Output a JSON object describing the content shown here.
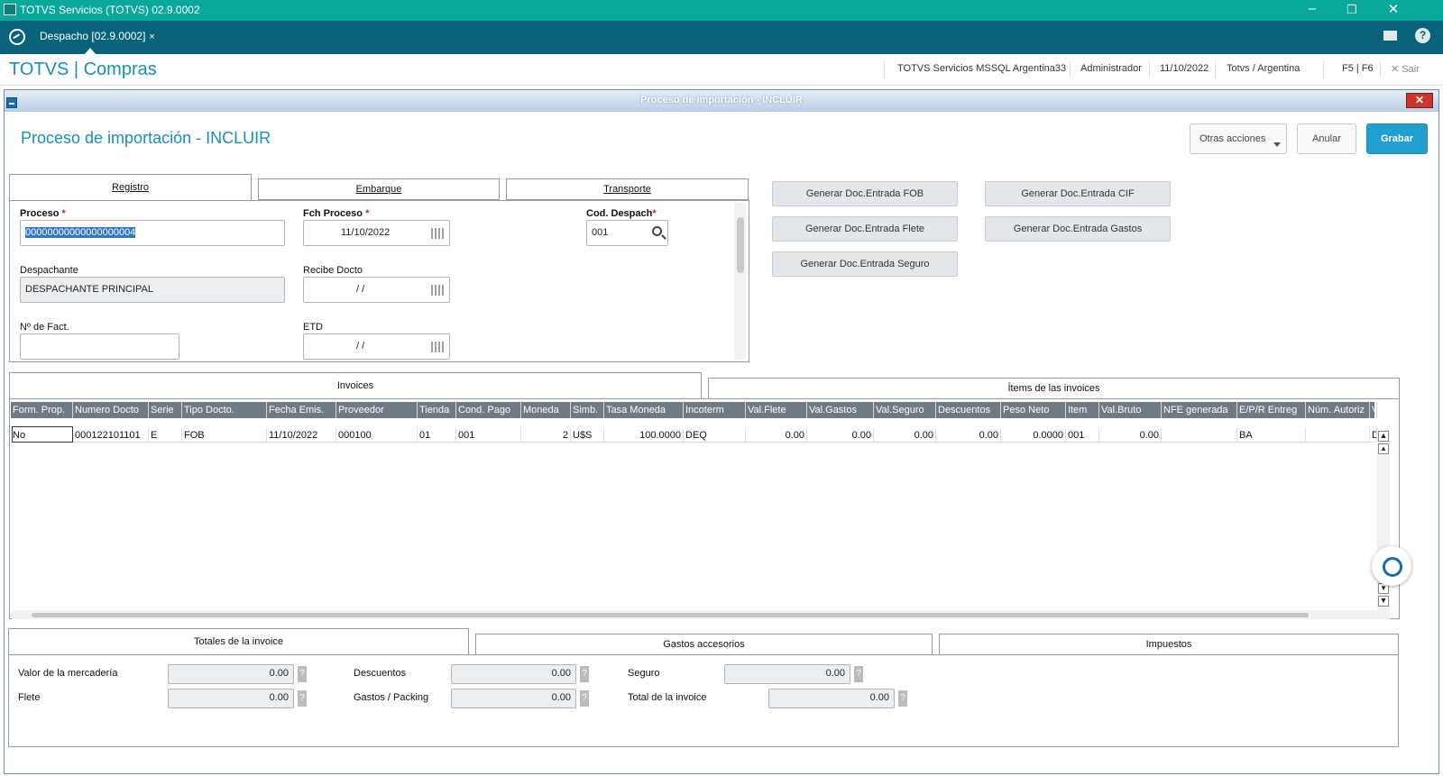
{
  "window": {
    "title": "TOTVS Servicios (TOTVS) 02.9.0002",
    "minimize": "–",
    "maximize": "❐",
    "close": "✕"
  },
  "tab": {
    "label": "Despacho [02.9.0002]",
    "close": "×"
  },
  "topicons": {
    "help": "?"
  },
  "header": {
    "brand": "TOTVS | Compras",
    "server": "TOTVS Servicios MSSQL Argentina33",
    "user": "Administrador",
    "date": "11/10/2022",
    "branch": "Totvs / Argentina",
    "shortcut": "F5 | F6",
    "exit": "✕  Sair"
  },
  "dialog": {
    "bar_title": "Proceso de importación - INCLUIR",
    "page_title": "Proceso de importación - INCLUIR",
    "close": "✕",
    "actions": {
      "other": "Otras acciones",
      "cancel": "Anular",
      "save": "Grabar"
    }
  },
  "top_tabs": [
    "Registro",
    "Embarque",
    "Transporte"
  ],
  "form": {
    "proceso_label": "Proceso",
    "proceso_value": "00000000000000000004",
    "fch_label": "Fch Proceso",
    "fch_value": "11/10/2022",
    "cod_label": "Cod. Despach",
    "cod_value": "001",
    "desp_label": "Despachante",
    "desp_value": "DESPACHANTE PRINCIPAL",
    "recibe_label": "Recibe Docto",
    "recibe_value": "/ /",
    "fact_label": "Nº de Fact.",
    "fact_value": "",
    "etd_label": "ETD",
    "etd_value": "/ /",
    "req": "*"
  },
  "gen_buttons": {
    "fob": "Generar Doc.Entrada FOB",
    "cif": "Generar Doc.Entrada CIF",
    "flete": "Generar Doc.Entrada Flete",
    "gastos": "Generar Doc.Entrada Gastos",
    "seguro": "Generar Doc.Entrada Seguro"
  },
  "mid_tabs": [
    "Invoices",
    "Ítems de las invoices"
  ],
  "grid": {
    "columns": [
      "Form. Prop.",
      "Numero Docto",
      "Serie",
      "Tipo Docto.",
      "Fecha Emis.",
      "Proveedor",
      "Tienda",
      "Cond. Pago",
      "Moneda",
      "Simb.",
      "Tasa Moneda",
      "Incoterm",
      "Val.Flete",
      "Val.Gastos",
      "Val.Seguro",
      "Descuentos",
      "Peso Neto",
      "Item",
      "Val.Bruto",
      "NFE generada",
      "E/P/R Entreg",
      "Núm. Autoriz",
      "V"
    ],
    "rows": [
      [
        "No",
        "000122101101",
        "E",
        "FOB",
        "11/10/2022",
        "000100",
        "01",
        "001",
        "2",
        "U$S",
        "100.0000",
        "DEQ",
        "0.00",
        "0.00",
        "0.00",
        "0.00",
        "0.0000",
        "001",
        "0.00",
        "",
        "BA",
        "",
        "D"
      ]
    ]
  },
  "bottom_tabs": [
    "Totales de la invoice",
    "Gastos accesorios",
    "Impuestos"
  ],
  "totals": {
    "mercaderia_label": "Valor de la mercadería",
    "mercaderia_value": "0.00",
    "flete_label": "Flete",
    "flete_value": "0.00",
    "descuentos_label": "Descuentos",
    "descuentos_value": "0.00",
    "gastos_label": "Gastos / Packing",
    "gastos_value": "0.00",
    "seguro_label": "Seguro",
    "seguro_value": "0.00",
    "total_label": "Total de la invoice",
    "total_value": "0.00",
    "q": "?"
  },
  "colors": {
    "titlebar": "#0aa89a",
    "tabbar": "#08637a",
    "brand": "#1a8fb3",
    "primary": "#1fa0d0",
    "grid_header": "#6f7a82"
  }
}
